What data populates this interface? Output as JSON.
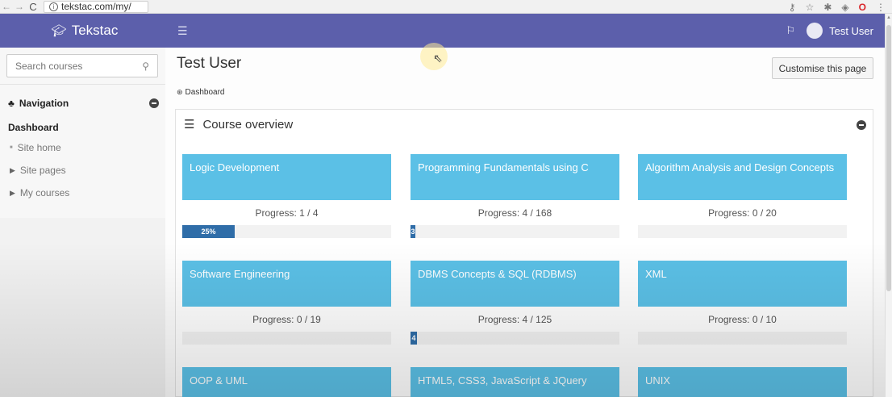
{
  "browser": {
    "url": "tekstac.com/my/",
    "back_icon": "back-arrow-icon",
    "forward_icon": "forward-arrow-icon",
    "reload_icon": "reload-icon"
  },
  "header": {
    "brand": "Tekstac",
    "user_name": "Test User",
    "bg_color": "#5c5fab"
  },
  "sidebar": {
    "search_placeholder": "Search courses",
    "navigation_title": "Navigation",
    "dashboard_label": "Dashboard",
    "items": [
      {
        "label": "Site home"
      },
      {
        "label": "Site pages"
      },
      {
        "label": "My courses"
      }
    ]
  },
  "main": {
    "page_title": "Test User",
    "customise_button": "Customise this page",
    "breadcrumb": "Dashboard",
    "block_title": "Course overview"
  },
  "courses": [
    {
      "name": "Logic Development",
      "progress_text": "Progress: 1 / 4",
      "progress_fraction": 0.25,
      "bar_label": "25%"
    },
    {
      "name": "Programming Fundamentals using C",
      "progress_text": "Progress: 4 / 168",
      "progress_fraction": 0.024,
      "bar_label": "3"
    },
    {
      "name": "Algorithm Analysis and Design Concepts",
      "progress_text": "Progress: 0 / 20",
      "progress_fraction": 0,
      "bar_label": ""
    },
    {
      "name": "Software Engineering",
      "progress_text": "Progress: 0 / 19",
      "progress_fraction": 0,
      "bar_label": ""
    },
    {
      "name": "DBMS Concepts & SQL (RDBMS)",
      "progress_text": "Progress: 4 / 125",
      "progress_fraction": 0.032,
      "bar_label": "4"
    },
    {
      "name": "XML",
      "progress_text": "Progress: 0 / 10",
      "progress_fraction": 0,
      "bar_label": ""
    },
    {
      "name": "OOP & UML",
      "progress_text": "",
      "progress_fraction": 0,
      "bar_label": ""
    },
    {
      "name": "HTML5, CSS3, JavaScript & JQuery",
      "progress_text": "",
      "progress_fraction": 0,
      "bar_label": ""
    },
    {
      "name": "UNIX",
      "progress_text": "",
      "progress_fraction": 0,
      "bar_label": ""
    }
  ],
  "colors": {
    "tile": "#5bc0e6",
    "progress_fill": "#2f6da8"
  }
}
